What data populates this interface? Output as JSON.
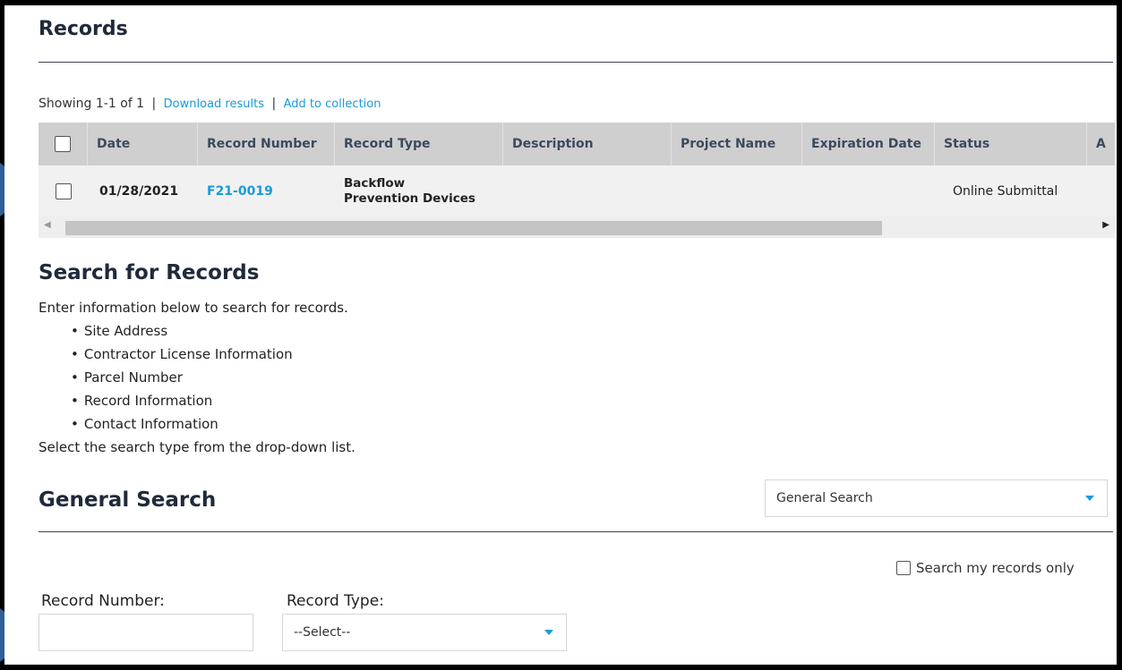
{
  "records": {
    "title": "Records",
    "showing": "Showing 1-1 of 1",
    "separator": "|",
    "download_link": "Download results",
    "collection_link": "Add to collection",
    "columns": [
      "Date",
      "Record Number",
      "Record Type",
      "Description",
      "Project Name",
      "Expiration Date",
      "Status",
      "A"
    ],
    "rows": [
      {
        "date": "01/28/2021",
        "record_number": "F21-0019",
        "record_type_line1": "Backflow",
        "record_type_line2": "Prevention Devices",
        "description": "",
        "project_name": "",
        "expiration_date": "",
        "status": "Online Submittal"
      }
    ]
  },
  "search": {
    "title": "Search for Records",
    "intro": "Enter information below to search for records.",
    "items": [
      "Site Address",
      "Contractor License Information",
      "Parcel Number",
      "Record Information",
      "Contact Information"
    ],
    "hint": "Select the search type from the drop-down list."
  },
  "general": {
    "title": "General Search",
    "search_type_value": "General Search",
    "my_records_label": "Search my records only",
    "record_number_label": "Record Number:",
    "record_number_value": "",
    "record_type_label": "Record Type:",
    "record_type_value": "--Select--"
  },
  "colors": {
    "link": "#1a9bd7",
    "arrow": "#2f5f97",
    "header_bg": "#cfcfcf"
  },
  "icons": {
    "scroll_left": "triangle-left-icon",
    "scroll_right": "triangle-right-icon",
    "dropdown": "caret-down-icon"
  }
}
